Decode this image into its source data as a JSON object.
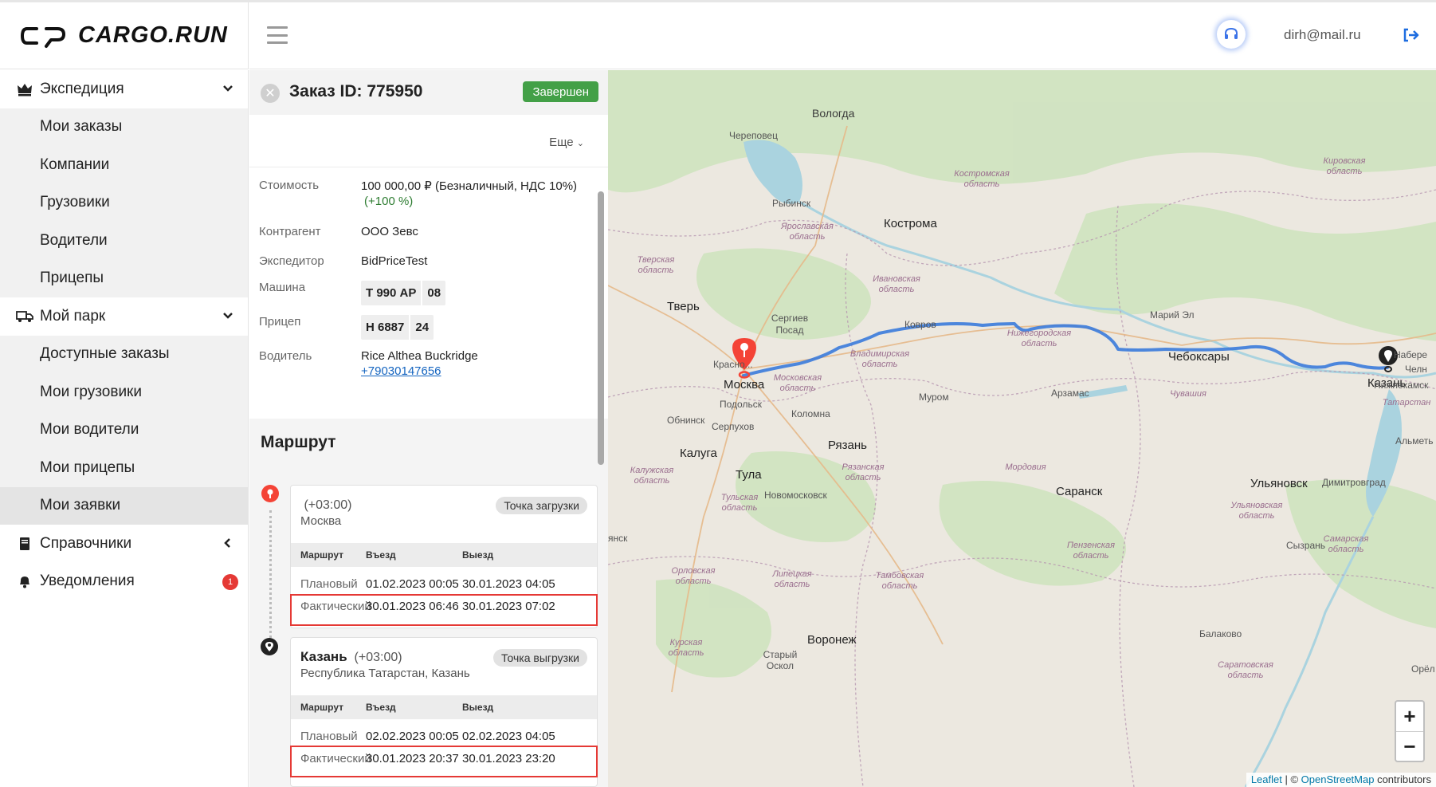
{
  "brand": {
    "name": "CARGO.RUN"
  },
  "header": {
    "user_email": "dirh@mail.ru"
  },
  "sidebar": {
    "groups": [
      {
        "label": "Экспедиция",
        "icon": "crown-icon",
        "items": [
          "Мои заказы",
          "Компании",
          "Грузовики",
          "Водители",
          "Прицепы"
        ]
      },
      {
        "label": "Мой парк",
        "icon": "truck-icon",
        "items": [
          "Доступные заказы",
          "Мои грузовики",
          "Мои водители",
          "Мои прицепы",
          "Мои заявки"
        ]
      },
      {
        "label": "Справочники",
        "icon": "book-icon"
      },
      {
        "label": "Уведомления",
        "icon": "bell-icon",
        "badge": "1"
      }
    ],
    "active_item": "Мои заявки"
  },
  "order": {
    "title": "Заказ ID: 775950",
    "status": "Завершен",
    "more_label": "Еще",
    "cost_label": "Стоимость",
    "cost_value": "100 000,00 ₽ (Безналичный, НДС 10%)",
    "cost_extra": "(+100 %)",
    "contractor_label": "Контрагент",
    "contractor_value": "ООО Зевс",
    "forwarder_label": "Экспедитор",
    "forwarder_value": "BidPriceTest",
    "truck_label": "Машина",
    "truck_plate": "Т 990 АР",
    "truck_region": "08",
    "trailer_label": "Прицеп",
    "trailer_plate": "Н 6887",
    "trailer_region": "24",
    "driver_label": "Водитель",
    "driver_name": "Rice Althea Buckridge",
    "driver_phone": "+79030147656"
  },
  "route": {
    "title": "Маршрут",
    "points": [
      {
        "city": "",
        "tz": "(+03:00)",
        "address": "Москва",
        "tag": "Точка загрузки",
        "headers": [
          "Маршрут",
          "Въезд",
          "Выезд"
        ],
        "rows": [
          [
            "Плановый",
            "01.02.2023 00:05",
            "30.01.2023 04:05"
          ],
          [
            "Фактический",
            "30.01.2023 06:46",
            "30.01.2023 07:02"
          ]
        ]
      },
      {
        "city": "Казань",
        "tz": "(+03:00)",
        "address": "Республика Татарстан, Казань",
        "tag": "Точка выгрузки",
        "headers": [
          "Маршрут",
          "Въезд",
          "Выезд"
        ],
        "rows": [
          [
            "Плановый",
            "02.02.2023 00:05",
            "02.02.2023 04:05"
          ],
          [
            "Фактический",
            "30.01.2023 20:37",
            "30.01.2023 23:20"
          ]
        ]
      }
    ]
  },
  "map": {
    "cities": [
      "Вологда",
      "Череповец",
      "Рыбинск",
      "Кострома",
      "Тверь",
      "Сергиев Посад",
      "Ковров",
      "Москва",
      "Красно...",
      "Подольск",
      "Муром",
      "Арзамас",
      "Чебоксары",
      "Казань",
      "Обнинск",
      "Серпухов",
      "Коломна",
      "Рязань",
      "Калуга",
      "Тула",
      "Новомосковск",
      "Саранск",
      "Ульяновск",
      "Димитровград",
      "Сызрань",
      "Воронеж",
      "Старый Оскол",
      "Балаково",
      "Набере",
      "Челн",
      "Нижнекамск",
      "Альметь",
      "Орёл",
      "Марий Эл",
      "янск"
    ],
    "regions": [
      "Кировская область",
      "Костромская область",
      "Ярославская область",
      "Тверская область",
      "Ивановская область",
      "Нижегородская область",
      "Владимирская область",
      "Московская область",
      "Чувашия",
      "Татарстан",
      "Калужская область",
      "Тульская область",
      "Рязанская область",
      "Мордовия",
      "Пензенская область",
      "Ульяновская область",
      "Самарская область",
      "Орловская область",
      "Липецкая область",
      "Тамбовская область",
      "Курская область",
      "Саратовская область"
    ],
    "attribution_leaflet": "Leaflet",
    "attribution_sep": " | © ",
    "attribution_osm": "OpenStreetMap",
    "attribution_tail": " contributors",
    "zoom_in": "+",
    "zoom_out": "−",
    "route_color": "#3b7bdc",
    "start_marker_color": "#f44336",
    "end_marker_color": "#222222"
  },
  "colors": {
    "status": "#43a047",
    "accent": "#1565c0",
    "highlight": "#e53935"
  }
}
